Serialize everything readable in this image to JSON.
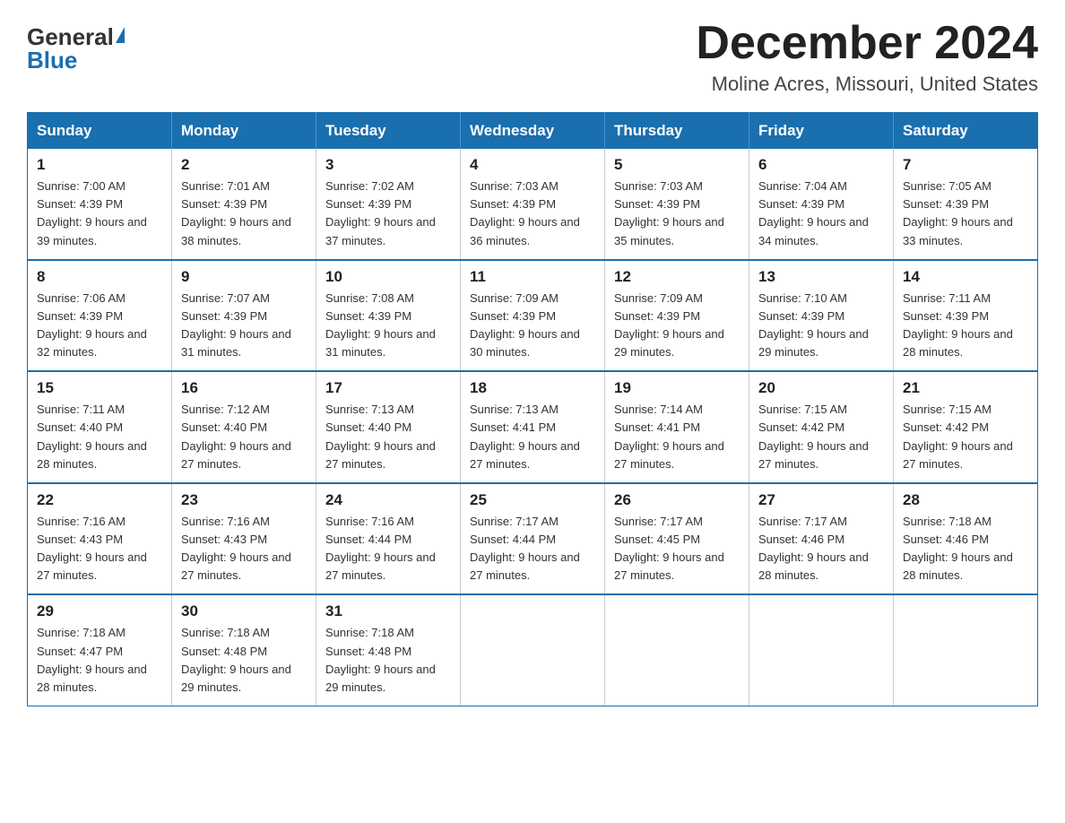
{
  "header": {
    "logo_general": "General",
    "logo_blue": "Blue",
    "title": "December 2024",
    "subtitle": "Moline Acres, Missouri, United States"
  },
  "days_of_week": [
    "Sunday",
    "Monday",
    "Tuesday",
    "Wednesday",
    "Thursday",
    "Friday",
    "Saturday"
  ],
  "weeks": [
    [
      {
        "day": "1",
        "sunrise": "7:00 AM",
        "sunset": "4:39 PM",
        "daylight": "9 hours and 39 minutes."
      },
      {
        "day": "2",
        "sunrise": "7:01 AM",
        "sunset": "4:39 PM",
        "daylight": "9 hours and 38 minutes."
      },
      {
        "day": "3",
        "sunrise": "7:02 AM",
        "sunset": "4:39 PM",
        "daylight": "9 hours and 37 minutes."
      },
      {
        "day": "4",
        "sunrise": "7:03 AM",
        "sunset": "4:39 PM",
        "daylight": "9 hours and 36 minutes."
      },
      {
        "day": "5",
        "sunrise": "7:03 AM",
        "sunset": "4:39 PM",
        "daylight": "9 hours and 35 minutes."
      },
      {
        "day": "6",
        "sunrise": "7:04 AM",
        "sunset": "4:39 PM",
        "daylight": "9 hours and 34 minutes."
      },
      {
        "day": "7",
        "sunrise": "7:05 AM",
        "sunset": "4:39 PM",
        "daylight": "9 hours and 33 minutes."
      }
    ],
    [
      {
        "day": "8",
        "sunrise": "7:06 AM",
        "sunset": "4:39 PM",
        "daylight": "9 hours and 32 minutes."
      },
      {
        "day": "9",
        "sunrise": "7:07 AM",
        "sunset": "4:39 PM",
        "daylight": "9 hours and 31 minutes."
      },
      {
        "day": "10",
        "sunrise": "7:08 AM",
        "sunset": "4:39 PM",
        "daylight": "9 hours and 31 minutes."
      },
      {
        "day": "11",
        "sunrise": "7:09 AM",
        "sunset": "4:39 PM",
        "daylight": "9 hours and 30 minutes."
      },
      {
        "day": "12",
        "sunrise": "7:09 AM",
        "sunset": "4:39 PM",
        "daylight": "9 hours and 29 minutes."
      },
      {
        "day": "13",
        "sunrise": "7:10 AM",
        "sunset": "4:39 PM",
        "daylight": "9 hours and 29 minutes."
      },
      {
        "day": "14",
        "sunrise": "7:11 AM",
        "sunset": "4:39 PM",
        "daylight": "9 hours and 28 minutes."
      }
    ],
    [
      {
        "day": "15",
        "sunrise": "7:11 AM",
        "sunset": "4:40 PM",
        "daylight": "9 hours and 28 minutes."
      },
      {
        "day": "16",
        "sunrise": "7:12 AM",
        "sunset": "4:40 PM",
        "daylight": "9 hours and 27 minutes."
      },
      {
        "day": "17",
        "sunrise": "7:13 AM",
        "sunset": "4:40 PM",
        "daylight": "9 hours and 27 minutes."
      },
      {
        "day": "18",
        "sunrise": "7:13 AM",
        "sunset": "4:41 PM",
        "daylight": "9 hours and 27 minutes."
      },
      {
        "day": "19",
        "sunrise": "7:14 AM",
        "sunset": "4:41 PM",
        "daylight": "9 hours and 27 minutes."
      },
      {
        "day": "20",
        "sunrise": "7:15 AM",
        "sunset": "4:42 PM",
        "daylight": "9 hours and 27 minutes."
      },
      {
        "day": "21",
        "sunrise": "7:15 AM",
        "sunset": "4:42 PM",
        "daylight": "9 hours and 27 minutes."
      }
    ],
    [
      {
        "day": "22",
        "sunrise": "7:16 AM",
        "sunset": "4:43 PM",
        "daylight": "9 hours and 27 minutes."
      },
      {
        "day": "23",
        "sunrise": "7:16 AM",
        "sunset": "4:43 PM",
        "daylight": "9 hours and 27 minutes."
      },
      {
        "day": "24",
        "sunrise": "7:16 AM",
        "sunset": "4:44 PM",
        "daylight": "9 hours and 27 minutes."
      },
      {
        "day": "25",
        "sunrise": "7:17 AM",
        "sunset": "4:44 PM",
        "daylight": "9 hours and 27 minutes."
      },
      {
        "day": "26",
        "sunrise": "7:17 AM",
        "sunset": "4:45 PM",
        "daylight": "9 hours and 27 minutes."
      },
      {
        "day": "27",
        "sunrise": "7:17 AM",
        "sunset": "4:46 PM",
        "daylight": "9 hours and 28 minutes."
      },
      {
        "day": "28",
        "sunrise": "7:18 AM",
        "sunset": "4:46 PM",
        "daylight": "9 hours and 28 minutes."
      }
    ],
    [
      {
        "day": "29",
        "sunrise": "7:18 AM",
        "sunset": "4:47 PM",
        "daylight": "9 hours and 28 minutes."
      },
      {
        "day": "30",
        "sunrise": "7:18 AM",
        "sunset": "4:48 PM",
        "daylight": "9 hours and 29 minutes."
      },
      {
        "day": "31",
        "sunrise": "7:18 AM",
        "sunset": "4:48 PM",
        "daylight": "9 hours and 29 minutes."
      },
      null,
      null,
      null,
      null
    ]
  ]
}
